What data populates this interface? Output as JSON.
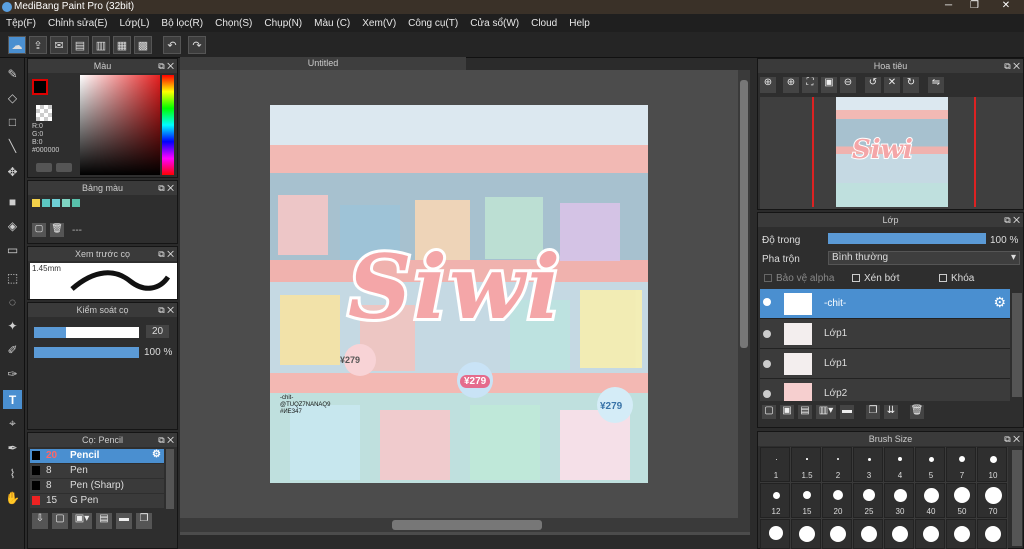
{
  "window": {
    "title": "MediBang Paint Pro (32bit)"
  },
  "menu": [
    "Tệp(F)",
    "Chỉnh sửa(E)",
    "Lớp(L)",
    "Bộ lọc(R)",
    "Chọn(S)",
    "Chụp(N)",
    "Màu (C)",
    "Xem(V)",
    "Công cụ(T)",
    "Cửa sổ(W)",
    "Cloud",
    "Help"
  ],
  "color_panel": {
    "title": "Màu",
    "r": "R:0",
    "g": "G:0",
    "b": "B:0",
    "hex": "#000000"
  },
  "palette_panel": {
    "title": "Bảng màu",
    "field": "---"
  },
  "preview_panel": {
    "title": "Xem trước cọ",
    "size": "1.45mm"
  },
  "brush_control": {
    "title": "Kiểm soát cọ",
    "size": "20",
    "opacity": "100 %",
    "size_fill": 0.3,
    "opacity_fill": 1.0
  },
  "brush_list": {
    "title": "Cọ: Pencil",
    "items": [
      {
        "size": "20",
        "name": "Pencil"
      },
      {
        "size": "8",
        "name": "Pen"
      },
      {
        "size": "8",
        "name": "Pen (Sharp)"
      },
      {
        "size": "15",
        "name": "G Pen"
      }
    ]
  },
  "canvas": {
    "tab": "Untitled",
    "art_text": "Siwi",
    "stamp": "-chit- @TUQZ7NANAQ9 #ИЕЗ47",
    "tags": [
      "¥279",
      "¥279",
      "¥279"
    ]
  },
  "navigator": {
    "title": "Hoa tiêu"
  },
  "layers": {
    "title": "Lớp",
    "opacity_label": "Độ trong",
    "opacity_value": "100 %",
    "opacity_fill": 1.0,
    "blend_label": "Pha trộn",
    "blend_value": "Bình thường",
    "protect_alpha": "Bảo vệ alpha",
    "clipping": "Xén bớt",
    "lock": "Khóa",
    "items": [
      "-chit-",
      "Lớp1",
      "Lớp1",
      "Lớp2"
    ]
  },
  "brush_size": {
    "title": "Brush Size",
    "row1": [
      "1",
      "1.5",
      "2",
      "3",
      "4",
      "5",
      "7",
      "10"
    ],
    "row2": [
      "12",
      "15",
      "20",
      "25",
      "30",
      "40",
      "50",
      "70"
    ]
  },
  "colors": {
    "accent": "#4a8fd0",
    "pink": "#f4a6a8"
  }
}
